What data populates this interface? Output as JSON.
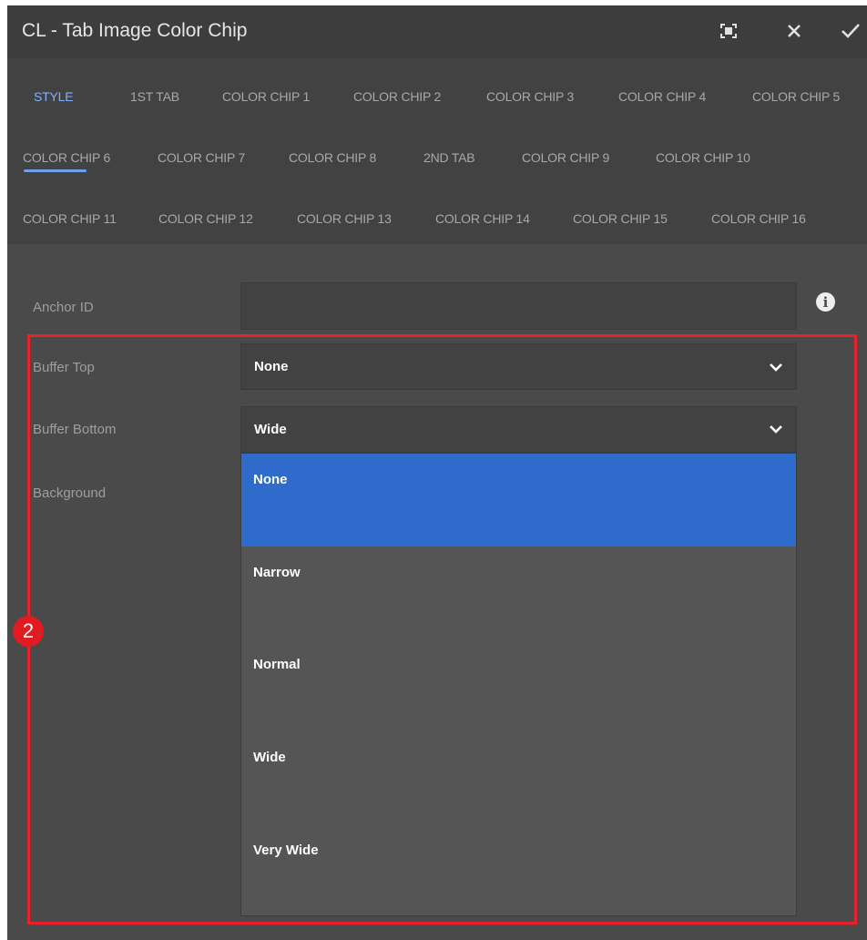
{
  "dialog": {
    "title": "CL - Tab Image Color Chip",
    "icons": {
      "fullscreen": "fullscreen-icon",
      "close": "close-icon",
      "confirm": "checkmark-icon"
    }
  },
  "tabs": [
    {
      "label": "STYLE",
      "active": true
    },
    {
      "label": "1ST TAB"
    },
    {
      "label": "COLOR CHIP 1"
    },
    {
      "label": "COLOR CHIP 2"
    },
    {
      "label": "COLOR CHIP 3"
    },
    {
      "label": "COLOR CHIP 4"
    },
    {
      "label": "COLOR CHIP 5"
    },
    {
      "label": "COLOR CHIP 6"
    },
    {
      "label": "COLOR CHIP 7"
    },
    {
      "label": "COLOR CHIP 8"
    },
    {
      "label": "2ND TAB"
    },
    {
      "label": "COLOR CHIP 9"
    },
    {
      "label": "COLOR CHIP 10"
    },
    {
      "label": "COLOR CHIP 11"
    },
    {
      "label": "COLOR CHIP 12"
    },
    {
      "label": "COLOR CHIP 13"
    },
    {
      "label": "COLOR CHIP 14"
    },
    {
      "label": "COLOR CHIP 15"
    },
    {
      "label": "COLOR CHIP 16"
    }
  ],
  "form": {
    "anchor_id": {
      "label": "Anchor ID",
      "value": ""
    },
    "buffer_top": {
      "label": "Buffer Top",
      "value": "None"
    },
    "buffer_bottom": {
      "label": "Buffer Bottom",
      "value": "Wide"
    },
    "background": {
      "label": "Background"
    }
  },
  "dropdown": {
    "options": [
      "None",
      "Narrow",
      "Normal",
      "Wide",
      "Very Wide"
    ],
    "highlighted": "None"
  },
  "annotation": {
    "marker": "2"
  },
  "colors": {
    "accent": "#6ea1ea",
    "selected": "#2e6bca",
    "annotation": "#e8212a"
  }
}
